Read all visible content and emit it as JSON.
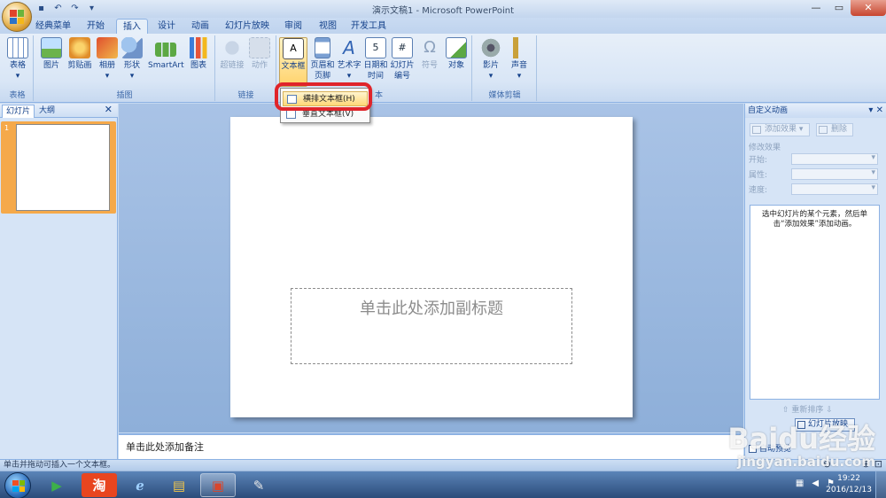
{
  "window": {
    "title": "演示文稿1 - Microsoft PowerPoint",
    "controls": [
      "minimize",
      "maximize",
      "close"
    ]
  },
  "quick_access": [
    "save-icon",
    "undo-icon",
    "redo-icon",
    "customize-icon"
  ],
  "tabs": [
    {
      "label": "经典菜单",
      "active": false
    },
    {
      "label": "开始",
      "active": false
    },
    {
      "label": "插入",
      "active": true
    },
    {
      "label": "设计",
      "active": false
    },
    {
      "label": "动画",
      "active": false
    },
    {
      "label": "幻灯片放映",
      "active": false
    },
    {
      "label": "审阅",
      "active": false
    },
    {
      "label": "视图",
      "active": false
    },
    {
      "label": "开发工具",
      "active": false
    }
  ],
  "ribbon": {
    "groups": [
      {
        "label": "表格",
        "buttons": [
          {
            "label": "表格",
            "icon": "table-icon"
          }
        ]
      },
      {
        "label": "插图",
        "buttons": [
          {
            "label": "图片",
            "icon": "picture-icon"
          },
          {
            "label": "剪贴画",
            "icon": "clipart-icon"
          },
          {
            "label": "相册",
            "icon": "album-icon"
          },
          {
            "label": "形状",
            "icon": "shapes-icon"
          },
          {
            "label": "SmartArt",
            "icon": "smartart-icon"
          },
          {
            "label": "图表",
            "icon": "chart-icon"
          }
        ]
      },
      {
        "label": "链接",
        "buttons": [
          {
            "label": "超链接",
            "icon": "hyperlink-icon",
            "disabled": true
          },
          {
            "label": "动作",
            "icon": "action-icon",
            "disabled": true
          }
        ]
      },
      {
        "label": "文本",
        "buttons": [
          {
            "label": "文本框",
            "icon": "textbox-icon",
            "selected": true
          },
          {
            "label": "页眉和页脚",
            "icon": "header-footer-icon"
          },
          {
            "label": "艺术字",
            "icon": "wordart-icon"
          },
          {
            "label": "日期和时间",
            "icon": "datetime-icon"
          },
          {
            "label": "幻灯片编号",
            "icon": "slide-number-icon"
          },
          {
            "label": "符号",
            "icon": "symbol-icon",
            "disabled": true
          },
          {
            "label": "对象",
            "icon": "object-icon"
          }
        ]
      },
      {
        "label": "媒体剪辑",
        "buttons": [
          {
            "label": "影片",
            "icon": "movie-icon"
          },
          {
            "label": "声音",
            "icon": "sound-icon"
          }
        ]
      }
    ],
    "visible_button_texts": {
      "header_footer_line1": "页眉和",
      "header_footer_line2": "页脚",
      "wordart_line1": "艺术字",
      "datetime_line1": "日期和",
      "datetime_line2": "时间",
      "slidenum_line1": "幻灯片",
      "slidenum_line2": "编号"
    },
    "text_group_label_partial": "本"
  },
  "textbox_menu": {
    "items": [
      {
        "label": "横排文本框(H)",
        "highlighted": true
      },
      {
        "label": "垂直文本框(V)",
        "highlighted": false
      }
    ]
  },
  "left_panel": {
    "tabs": [
      "幻灯片",
      "大纲"
    ],
    "slide_numbers": [
      "1"
    ]
  },
  "slide": {
    "subtitle_placeholder": "单击此处添加副标题"
  },
  "notes": {
    "placeholder": "单击此处添加备注"
  },
  "right_panel": {
    "title": "自定义动画",
    "add_effect": "添加效果",
    "remove": "删除",
    "modify_section": "修改效果",
    "fields": [
      "开始:",
      "属性:",
      "速度:"
    ],
    "hint": "选中幻灯片的某个元素，然后单击“添加效果”添加动画。",
    "reorder": "重新排序",
    "play": "幻灯片放映",
    "autopreview": "自动预览"
  },
  "status_bar": {
    "text": "单击并拖动可插入一个文本框。"
  },
  "taskbar": {
    "clock_time": "19:22",
    "clock_date": "2016/12/13",
    "apps": [
      "ie-icon",
      "explorer-icon",
      "powerpoint-icon",
      "paint-icon"
    ]
  },
  "watermark": {
    "brand": "Baidu经验",
    "url": "jingyan.baidu.com"
  },
  "colors": {
    "accent": "#15428b",
    "highlight_ring": "#e0242a",
    "menu_highlight": "#ffd877",
    "thumb_selected": "#f5a94a"
  }
}
